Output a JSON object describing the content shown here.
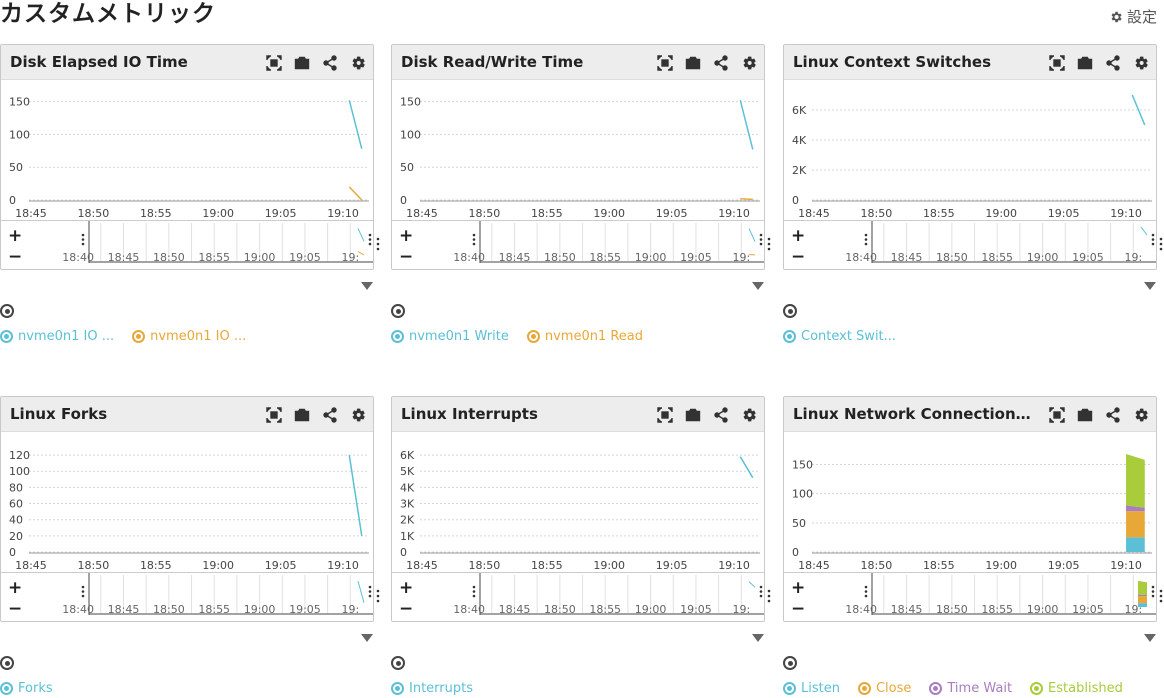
{
  "page": {
    "title": "カスタムメトリック",
    "settings_label": "設定"
  },
  "nav_ticks": [
    "18:40",
    "18:45",
    "18:50",
    "18:55",
    "19:00",
    "19:05",
    "19:"
  ],
  "x_ticks": [
    "18:45",
    "18:50",
    "18:55",
    "19:00",
    "19:05",
    "19:10"
  ],
  "colors": {
    "cyan": "#5bc0d6",
    "orange": "#e8a838",
    "purple": "#a87ec0",
    "green": "#a8cc3a",
    "grid": "#d5d5d5",
    "axis": "#888"
  },
  "charts": [
    {
      "title": "Disk Elapsed IO Time",
      "chart_data": {
        "type": "line",
        "x": [
          "19:10:30",
          "19:11:30"
        ],
        "ylim": [
          0,
          160
        ],
        "y_ticks": [
          0,
          50,
          100,
          150
        ],
        "y_tick_labels": [
          "0",
          "50",
          "100",
          "150"
        ],
        "series": [
          {
            "name": "nvme0n1 IO ...",
            "color": "#5bc0d6",
            "values": [
              152,
              78
            ]
          },
          {
            "name": "nvme0n1 IO ...",
            "color": "#e8a838",
            "values": [
              20,
              0
            ]
          }
        ]
      }
    },
    {
      "title": "Disk Read/Write Time",
      "chart_data": {
        "type": "line",
        "x": [
          "19:10:30",
          "19:11:30"
        ],
        "ylim": [
          0,
          160
        ],
        "y_ticks": [
          0,
          50,
          100,
          150
        ],
        "y_tick_labels": [
          "0",
          "50",
          "100",
          "150"
        ],
        "series": [
          {
            "name": "nvme0n1 Write",
            "color": "#5bc0d6",
            "values": [
              152,
              77
            ]
          },
          {
            "name": "nvme0n1 Read",
            "color": "#e8a838",
            "values": [
              2,
              1
            ]
          }
        ]
      }
    },
    {
      "title": "Linux Context Switches",
      "chart_data": {
        "type": "line",
        "x": [
          "19:10:30",
          "19:11:30"
        ],
        "ylim": [
          0,
          7000
        ],
        "y_ticks": [
          0,
          2000,
          4000,
          6000
        ],
        "y_tick_labels": [
          "0",
          "2K",
          "4K",
          "6K"
        ],
        "series": [
          {
            "name": "Context Swit...",
            "color": "#5bc0d6",
            "values": [
              7000,
              5000
            ]
          }
        ]
      }
    },
    {
      "title": "Linux Forks",
      "chart_data": {
        "type": "line",
        "x": [
          "19:10:30",
          "19:11:30"
        ],
        "ylim": [
          0,
          130
        ],
        "y_ticks": [
          0,
          20,
          40,
          60,
          80,
          100,
          120
        ],
        "y_tick_labels": [
          "0",
          "20",
          "40",
          "60",
          "80",
          "100",
          "120"
        ],
        "series": [
          {
            "name": "Forks",
            "color": "#5bc0d6",
            "values": [
              120,
              20
            ]
          }
        ]
      }
    },
    {
      "title": "Linux Interrupts",
      "chart_data": {
        "type": "line",
        "x": [
          "19:10:30",
          "19:11:30"
        ],
        "ylim": [
          0,
          6500
        ],
        "y_ticks": [
          0,
          1000,
          2000,
          3000,
          4000,
          5000,
          6000
        ],
        "y_tick_labels": [
          "0",
          "1K",
          "2K",
          "3K",
          "4K",
          "5K",
          "6K"
        ],
        "series": [
          {
            "name": "Interrupts",
            "color": "#5bc0d6",
            "values": [
              5900,
              4600
            ]
          }
        ]
      }
    },
    {
      "title": "Linux Network Connection St...",
      "chart_data": {
        "type": "area",
        "x": [
          "19:10:00",
          "19:11:30"
        ],
        "ylim": [
          0,
          180
        ],
        "y_ticks": [
          0,
          50,
          100,
          150
        ],
        "y_tick_labels": [
          "0",
          "50",
          "100",
          "150"
        ],
        "series": [
          {
            "name": "Listen",
            "color": "#5bc0d6",
            "values": [
              25,
              25
            ]
          },
          {
            "name": "Close",
            "color": "#e8a838",
            "values": [
              45,
              45
            ]
          },
          {
            "name": "Time Wait",
            "color": "#a87ec0",
            "values": [
              10,
              6
            ]
          },
          {
            "name": "Established",
            "color": "#a8cc3a",
            "values": [
              88,
              82
            ]
          }
        ]
      }
    }
  ]
}
